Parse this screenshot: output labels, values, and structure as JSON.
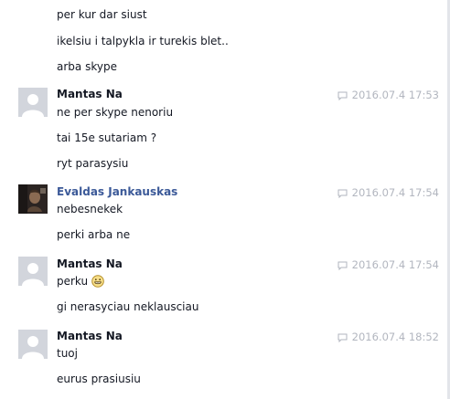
{
  "top_messages": [
    "per kur dar siust",
    "ikelsiu i talpykla ir turekis blet..",
    "arba skype"
  ],
  "groups": [
    {
      "sender": "Mantas Na",
      "timestamp": "2016.07.4 17:53",
      "messages": [
        "ne per skype nenoriu",
        "tai 15e sutariam ?",
        "ryt parasysiu"
      ]
    },
    {
      "sender": "Evaldas Jankauskas",
      "timestamp": "2016.07.4 17:54",
      "messages": [
        "nebesnekek",
        "perki arba ne"
      ]
    },
    {
      "sender": "Mantas Na",
      "timestamp": "2016.07.4 17:54",
      "messages": [
        "perku",
        "gi nerasyciau neklausciau"
      ]
    },
    {
      "sender": "Mantas Na",
      "timestamp": "2016.07.4 18:52",
      "messages": [
        "tuoj",
        "eurus prasiusiu"
      ]
    }
  ],
  "icons": {
    "timestamp": "chat-bubble-icon",
    "emoji": "grin-emoji-icon",
    "avatar_default": "default-person-silhouette",
    "avatar_photo": "profile-photo"
  },
  "colors": {
    "sender_link": "#3b5998",
    "timestamp": "#b2b6bf",
    "text": "#141823"
  }
}
